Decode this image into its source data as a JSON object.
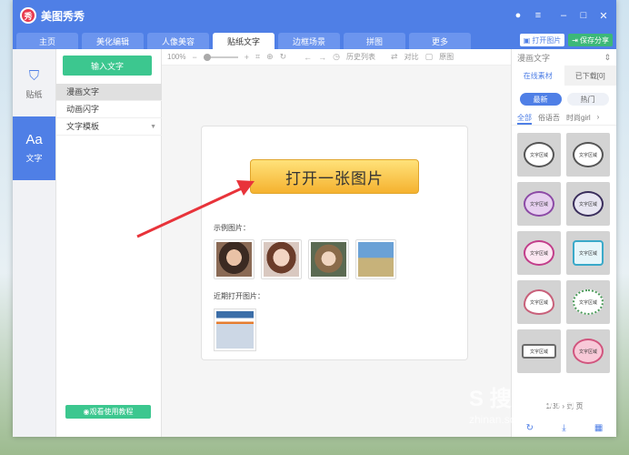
{
  "app": {
    "logo_text": "秀",
    "name": "美图秀秀"
  },
  "tabs": [
    "主页",
    "美化编辑",
    "人像美容",
    "贴纸文字",
    "边框场景",
    "拼图",
    "更多"
  ],
  "header_buttons": {
    "open": "打开图片",
    "save": "保存分享"
  },
  "leftnav": [
    {
      "label": "贴纸",
      "icon": "sticker-icon"
    },
    {
      "label": "文字",
      "icon": "text-icon"
    }
  ],
  "panel": {
    "input_button": "输入文字",
    "items": [
      "漫画文字",
      "动画闪字",
      "文字模板"
    ],
    "tutorial_button": "观看使用教程"
  },
  "toolbar": {
    "zoom": "100%",
    "history": "历史列表",
    "compare": "对比",
    "original": "原图"
  },
  "canvas": {
    "open_button": "打开一张图片",
    "sample_label": "示例图片：",
    "recent_label": "近期打开图片："
  },
  "rpanel": {
    "title": "漫画文字",
    "tabs": [
      "在线素材",
      "已下载[0]"
    ],
    "pills": [
      "最新",
      "热门"
    ],
    "categories": [
      "全部",
      "俗语吾",
      "时尚girl"
    ],
    "sticker_text": "文字区域",
    "pager": "1/35 ›  到   页"
  },
  "watermark": {
    "main": "S 搜狗指南",
    "sub": "zhinan.sogou.com"
  }
}
